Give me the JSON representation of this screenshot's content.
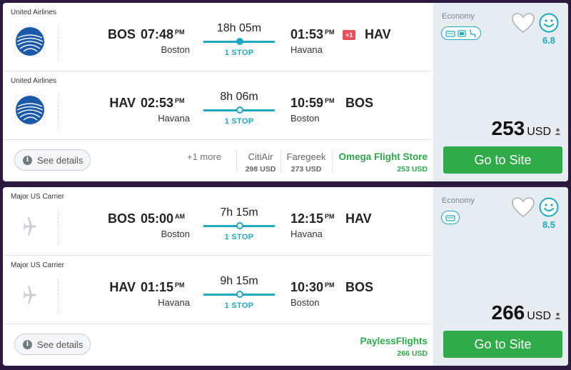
{
  "results": [
    {
      "legs": [
        {
          "carrier": "United Airlines",
          "logo": "united-airlines-globe-logo",
          "dep_code": "BOS",
          "dep_time": "07:48",
          "dep_ampm": "PM",
          "dep_city": "Boston",
          "duration": "18h 05m",
          "stops": "1 STOP",
          "arr_time": "01:53",
          "arr_ampm": "PM",
          "arr_city": "Havana",
          "day_offset": "+1",
          "arr_code": "HAV"
        },
        {
          "carrier": "United Airlines",
          "logo": "united-airlines-globe-logo",
          "dep_code": "HAV",
          "dep_time": "02:53",
          "dep_ampm": "PM",
          "dep_city": "Havana",
          "duration": "8h 06m",
          "stops": "1 STOP",
          "arr_time": "10:59",
          "arr_ampm": "PM",
          "arr_city": "Boston",
          "arr_code": "BOS"
        }
      ],
      "see_details": "See details",
      "more": "+1 more",
      "providers": [
        {
          "name": "CitiAir",
          "price": "298 USD"
        },
        {
          "name": "Faregeek",
          "price": "273 USD"
        },
        {
          "name": "Omega Flight Store",
          "price": "253 USD"
        }
      ],
      "cabin": "Economy",
      "amenities": [
        "wifi-icon",
        "entertainment-icon",
        "legroom-icon"
      ],
      "score": "6.8",
      "price": "253",
      "currency": "USD",
      "cta": "Go to Site"
    },
    {
      "legs": [
        {
          "carrier": "Major US Carrier",
          "logo": "airplane-icon",
          "dep_code": "BOS",
          "dep_time": "05:00",
          "dep_ampm": "AM",
          "dep_city": "Boston",
          "duration": "7h 15m",
          "stops": "1 STOP",
          "arr_time": "12:15",
          "arr_ampm": "PM",
          "arr_city": "Havana",
          "arr_code": "HAV"
        },
        {
          "carrier": "Major US Carrier",
          "logo": "airplane-icon",
          "dep_code": "HAV",
          "dep_time": "01:15",
          "dep_ampm": "PM",
          "dep_city": "Havana",
          "duration": "9h 15m",
          "stops": "1 STOP",
          "arr_time": "10:30",
          "arr_ampm": "PM",
          "arr_city": "Boston",
          "arr_code": "BOS"
        }
      ],
      "see_details": "See details",
      "providers": [
        {
          "name": "PaylessFlights",
          "price": "266 USD"
        }
      ],
      "cabin": "Economy",
      "amenities": [
        "wifi-icon"
      ],
      "score": "8.5",
      "price": "266",
      "currency": "USD",
      "cta": "Go to Site"
    }
  ],
  "colors": {
    "accent": "#1fa8c6",
    "cta": "#31aa4a",
    "badge": "#e8515b",
    "best_provider": "#2ea84a"
  }
}
